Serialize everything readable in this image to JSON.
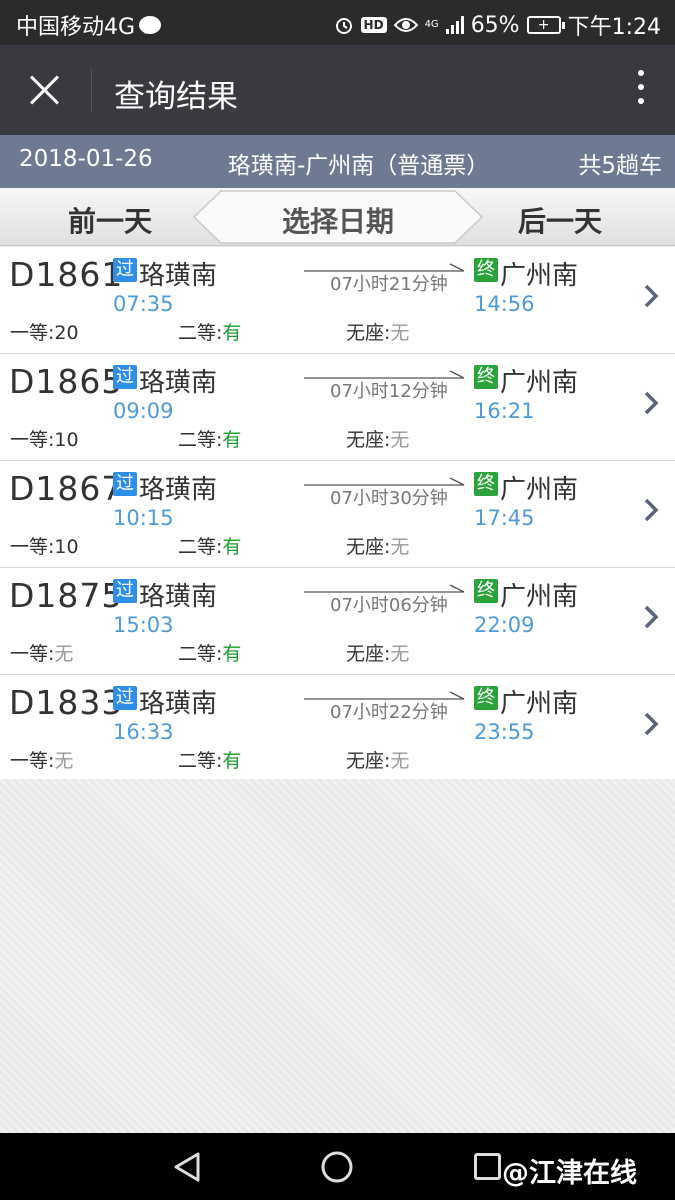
{
  "status_bar": {
    "carrier": "中国移动4G",
    "signal_tech": "4G",
    "battery": "65%",
    "time": "下午1:24"
  },
  "title_bar": {
    "title": "查询结果"
  },
  "info_bar": {
    "date": "2018-01-26",
    "route": "珞璜南-广州南（普通票）",
    "count": "共5趟车"
  },
  "day_nav": {
    "prev_label": "前一天",
    "select_label": "选择日期",
    "next_label": "后一天"
  },
  "trains": [
    {
      "no": "D1861",
      "pass_badge": "过",
      "from": "珞璜南",
      "dep": "07:35",
      "duration": "07小时21分钟",
      "end_badge": "终",
      "to": "广州南",
      "arr": "14:56",
      "first_label": "一等:",
      "first": "20",
      "second_label": "二等:",
      "second": "有",
      "none_label": "无座:",
      "none": "无"
    },
    {
      "no": "D1865",
      "pass_badge": "过",
      "from": "珞璜南",
      "dep": "09:09",
      "duration": "07小时12分钟",
      "end_badge": "终",
      "to": "广州南",
      "arr": "16:21",
      "first_label": "一等:",
      "first": "10",
      "second_label": "二等:",
      "second": "有",
      "none_label": "无座:",
      "none": "无"
    },
    {
      "no": "D1867",
      "pass_badge": "过",
      "from": "珞璜南",
      "dep": "10:15",
      "duration": "07小时30分钟",
      "end_badge": "终",
      "to": "广州南",
      "arr": "17:45",
      "first_label": "一等:",
      "first": "10",
      "second_label": "二等:",
      "second": "有",
      "none_label": "无座:",
      "none": "无"
    },
    {
      "no": "D1875",
      "pass_badge": "过",
      "from": "珞璜南",
      "dep": "15:03",
      "duration": "07小时06分钟",
      "end_badge": "终",
      "to": "广州南",
      "arr": "22:09",
      "first_label": "一等:",
      "first": "无",
      "second_label": "二等:",
      "second": "有",
      "none_label": "无座:",
      "none": "无"
    },
    {
      "no": "D1833",
      "pass_badge": "过",
      "from": "珞璜南",
      "dep": "16:33",
      "duration": "07小时22分钟",
      "end_badge": "终",
      "to": "广州南",
      "arr": "23:55",
      "first_label": "一等:",
      "first": "无",
      "second_label": "二等:",
      "second": "有",
      "none_label": "无座:",
      "none": "无"
    }
  ],
  "watermark": "@江津在线",
  "colors": {
    "title_bar": "#393a3f",
    "info_bar": "#6d7a92",
    "time_blue": "#4f9bd8",
    "available_green": "#1b9e2e",
    "unavailable_gray": "#999999",
    "pass_badge": "#2f8ee6",
    "end_badge": "#2aa33a"
  },
  "icons": [
    "close-icon",
    "more-icon",
    "chevron-right-icon",
    "nav-back-icon",
    "nav-home-icon",
    "nav-recent-icon"
  ]
}
